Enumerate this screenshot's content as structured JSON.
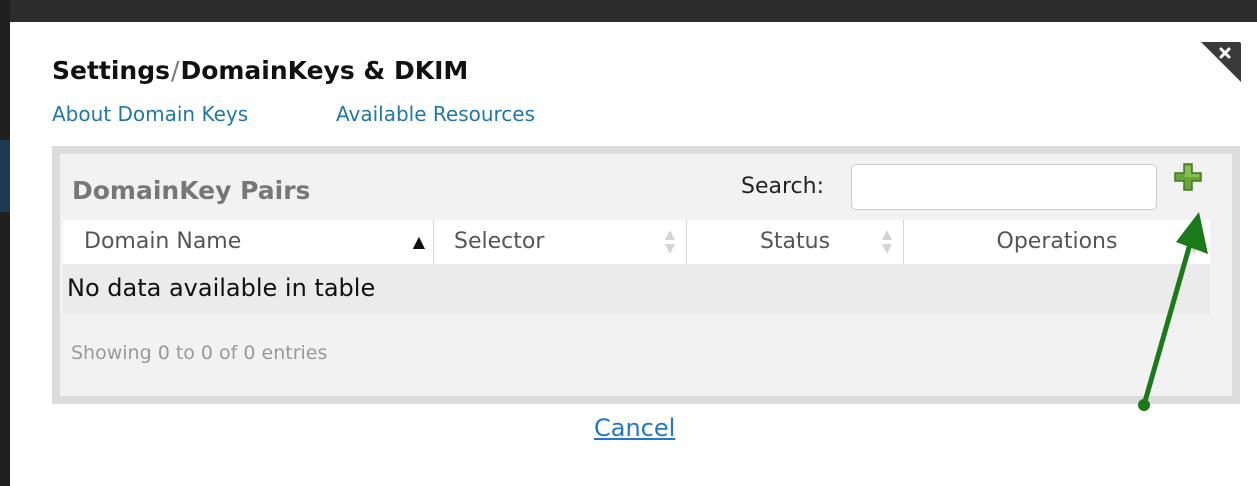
{
  "dialog": {
    "title_part1": "Settings",
    "title_separator": "/",
    "title_part2": "DomainKeys & DKIM",
    "close_icon": "close-x-icon",
    "links": {
      "about": "About Domain Keys",
      "resources": "Available Resources"
    }
  },
  "panel": {
    "title": "DomainKey Pairs",
    "search_label": "Search:",
    "search_value": "",
    "search_placeholder": "",
    "add_icon": "plus-icon",
    "columns": [
      {
        "label": "Domain Name",
        "sort": "ascending"
      },
      {
        "label": "Selector",
        "sort": "none"
      },
      {
        "label": "Status",
        "sort": "none"
      },
      {
        "label": "Operations",
        "sort": "none"
      }
    ],
    "empty_message": "No data available in table",
    "info": "Showing 0 to 0 of 0 entries"
  },
  "footer": {
    "cancel_label": "Cancel"
  },
  "annotation": {
    "arrow_icon": "green-arrow-icon",
    "color": "#1a7a1a"
  },
  "colors": {
    "link": "#2277aa",
    "add_button": "#6aa33a",
    "panel_border": "#dcdcdc"
  }
}
